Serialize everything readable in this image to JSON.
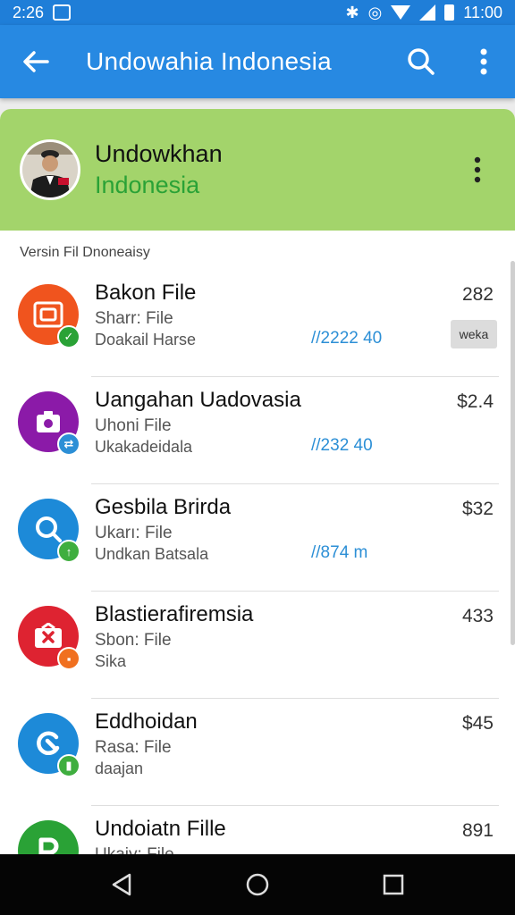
{
  "status_bar": {
    "left_text": "2:26",
    "time": "11:00"
  },
  "app_bar": {
    "title": "Undowahia Indonesia"
  },
  "account": {
    "name": "Undowkhan",
    "subtitle": "Indonesia"
  },
  "section_label": "Versin Fil Dnoneaisy",
  "rows": [
    {
      "name": "Bakon File",
      "type": "Sharr: File",
      "meta": "Doakail Harse",
      "link": "//2222 40",
      "price": "282",
      "chip": "weka",
      "icon_color": "#f0541e",
      "badge_color": "#2aa236",
      "badge_icon": "check-icon"
    },
    {
      "name": "Uangahan Uadovasia",
      "type": "Uhoni File",
      "meta": "Ukakadeidala",
      "link": "//232 40",
      "price": "$2.4",
      "chip": "",
      "icon_color": "#8b1aa8",
      "badge_color": "#2c8fd6",
      "badge_icon": "sync-icon"
    },
    {
      "name": "Gesbila Brirda",
      "type": "Ukarı: File",
      "meta": "Undkan Batsala",
      "link": "//874 m",
      "price": "$32",
      "chip": "",
      "icon_color": "#1d8ad8",
      "badge_color": "#3fae3f",
      "badge_icon": "upload-icon"
    },
    {
      "name": "Blastierafiremsia",
      "type": "Sbon: File",
      "meta": "Sika",
      "link": "",
      "price": "433",
      "chip": "",
      "icon_color": "#de2331",
      "badge_color": "#f07020",
      "badge_icon": "folder-icon"
    },
    {
      "name": "Eddhoidan",
      "type": "Rasa: File",
      "meta": "daajan",
      "link": "",
      "price": "$45",
      "chip": "",
      "icon_color": "#1d8ad8",
      "badge_color": "#3fae3f",
      "badge_icon": "lock-icon"
    },
    {
      "name": "Undoiatn Fille",
      "type": "Ukaiy: File",
      "meta": "",
      "link": "",
      "price": "891",
      "chip": "",
      "icon_color": "#2aa236",
      "badge_color": "#2aa236",
      "badge_icon": ""
    }
  ],
  "icons": {
    "back": "arrow-left-icon",
    "search": "search-icon",
    "more": "more-vertical-icon",
    "nav": [
      "nav-back-icon",
      "nav-home-icon",
      "nav-recents-icon"
    ]
  }
}
